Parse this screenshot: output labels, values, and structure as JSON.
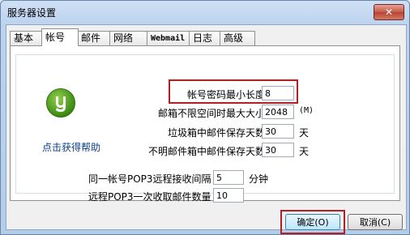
{
  "window": {
    "title": "服务器设置",
    "close_label": "✕"
  },
  "tabs": [
    {
      "label": "基本"
    },
    {
      "label": "帐号"
    },
    {
      "label": "邮件"
    },
    {
      "label": "网络"
    },
    {
      "label": "Webmail"
    },
    {
      "label": "日志"
    },
    {
      "label": "高级"
    }
  ],
  "active_tab": "帐号",
  "help": {
    "icon": "help-icon",
    "link": "点击获得帮助"
  },
  "fields": {
    "password_min_length": {
      "label": "帐号密码最小长度",
      "value": "8"
    },
    "mailbox_max_size": {
      "label": "邮箱不限空间时最大大小",
      "value": "2048",
      "unit": "(M)"
    },
    "trash_keep_days": {
      "label": "垃圾箱中邮件保存天数",
      "value": "30",
      "unit": "天"
    },
    "unknown_keep_days": {
      "label": "不明邮件箱中邮件保存天数",
      "value": "30",
      "unit": "天"
    },
    "pop3_interval": {
      "label": "同一帐号POP3远程接收间隔",
      "value": "5",
      "unit": "分钟"
    },
    "pop3_batch": {
      "label": "远程POP3一次收取邮件数量",
      "value": "10"
    }
  },
  "buttons": {
    "ok": "确定(O)",
    "cancel": "取消(C)"
  },
  "colors": {
    "highlight": "#b21f24",
    "icon_green": "#3d8a14",
    "link": "#0b3f8a"
  }
}
